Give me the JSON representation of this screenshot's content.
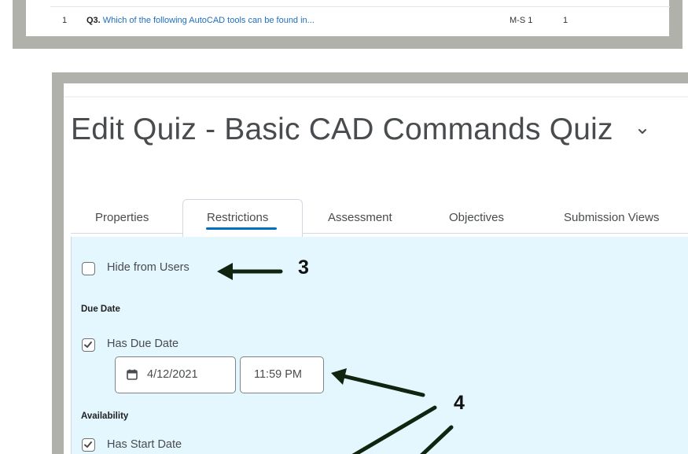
{
  "question_list": {
    "row": {
      "number": "1",
      "question_id": "Q3.",
      "question_text": "Which of the following AutoCAD tools can be found in...",
      "type": "M-S 1",
      "points": "1"
    }
  },
  "page": {
    "title": "Edit Quiz - Basic CAD Commands Quiz",
    "title_menu_icon": "chevron-down-icon"
  },
  "tabs": [
    {
      "label": "Properties",
      "active": false
    },
    {
      "label": "Restrictions",
      "active": true
    },
    {
      "label": "Assessment",
      "active": false
    },
    {
      "label": "Objectives",
      "active": false
    },
    {
      "label": "Submission Views",
      "active": false
    }
  ],
  "restrictions": {
    "hide_from_users": {
      "label": "Hide from Users",
      "checked": false
    },
    "due_date_section": "Due Date",
    "has_due_date": {
      "label": "Has Due Date",
      "checked": true
    },
    "due_date_value": "4/12/2021",
    "due_time_value": "11:59 PM",
    "due_date_icon": "calendar-icon",
    "availability_section": "Availability",
    "has_start_date": {
      "label": "Has Start Date",
      "checked": true
    }
  },
  "annotations": {
    "callout_3": "3",
    "callout_4": "4"
  },
  "colors": {
    "frame": "#b1b1ab",
    "content_bg": "#e4f6fe",
    "accent": "#006fbf",
    "link": "#1e6fbf",
    "text": "#494c4e"
  }
}
